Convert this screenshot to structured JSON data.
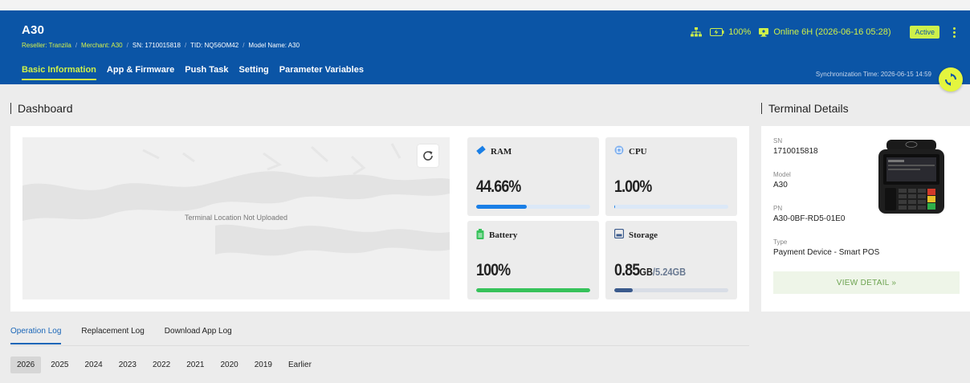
{
  "header": {
    "title": "A30",
    "breadcrumb": {
      "reseller": "Reseller: Tranzila",
      "merchant": "Merchant: A30",
      "sn": "SN: 1710015818",
      "tid": "TID: NQ56OM42",
      "model": "Model Name: A30"
    },
    "battery": "100%",
    "online": "Online 6H (2026-06-16 05:28)",
    "status_badge": "Active",
    "tabs": [
      "Basic Information",
      "App & Firmware",
      "Push Task",
      "Setting",
      "Parameter Variables"
    ],
    "sync_time": "Synchronization Time: 2026-06-15 14:59"
  },
  "dashboard": {
    "title": "Dashboard",
    "map_label": "Terminal Location Not Uploaded",
    "ram": {
      "label": "RAM",
      "value": "44.66%",
      "fraction": 0.4466
    },
    "cpu": {
      "label": "CPU",
      "value": "1.00%",
      "fraction": 0.01
    },
    "battery": {
      "label": "Battery",
      "value": "100%",
      "fraction": 1.0
    },
    "storage": {
      "label": "Storage",
      "used": "0.85",
      "used_unit": "GB",
      "total": "/5.24",
      "total_unit": "GB",
      "fraction": 0.162
    }
  },
  "logs": {
    "tabs": [
      "Operation Log",
      "Replacement Log",
      "Download App Log"
    ],
    "years": [
      "2026",
      "2025",
      "2024",
      "2023",
      "2022",
      "2021",
      "2020",
      "2019",
      "Earlier"
    ]
  },
  "terminal": {
    "title": "Terminal Details",
    "sn_label": "SN",
    "sn": "1710015818",
    "model_label": "Model",
    "model": "A30",
    "pn_label": "PN",
    "pn": "A30-0BF-RD5-01E0",
    "type_label": "Type",
    "type": "Payment Device - Smart POS",
    "view_detail": "VIEW DETAIL »"
  },
  "colors": {
    "header_bg": "#0b55a6",
    "accent_lime": "#cef04a",
    "ram_bar": "#1a7fe6",
    "battery_bar": "#36c25a",
    "storage_bar": "#3a5a8c"
  }
}
